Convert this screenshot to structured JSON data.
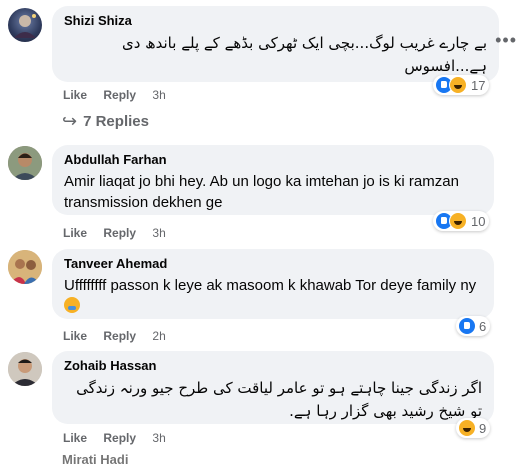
{
  "comments": [
    {
      "author": "Shizi Shiza",
      "text": "بے چارے غریب لوگ...بچی ایک ٹھرکی بڈھے کے پلے باندھ دی ہے...افسوس",
      "actions": {
        "like": "Like",
        "reply": "Reply",
        "time": "3h"
      },
      "reaction_count": "17",
      "reactions": [
        "like-icon",
        "haha-icon"
      ],
      "replies_label": "7 Replies"
    },
    {
      "author": "Abdullah Farhan",
      "text": "Amir liaqat jo bhi hey. Ab un logo ka imtehan jo is ki ramzan transmission dekhen ge",
      "actions": {
        "like": "Like",
        "reply": "Reply",
        "time": "3h"
      },
      "reaction_count": "10",
      "reactions": [
        "like-icon",
        "haha-icon"
      ]
    },
    {
      "author": "Tanveer Ahemad",
      "text": "Uffffffff passon k leye ak masoom k khawab Tor deye family ny",
      "actions": {
        "like": "Like",
        "reply": "Reply",
        "time": "2h"
      },
      "reaction_count": "6",
      "reactions": [
        "like-icon"
      ]
    },
    {
      "author": "Zohaib Hassan",
      "text": "اگر زندگی جینا چاہتے ہو تو عامر لیاقت کی طرح جیو ورنہ زندگی تو شیخ رشید بھی گزار رہا ہے.",
      "actions": {
        "like": "Like",
        "reply": "Reply",
        "time": "3h"
      },
      "reaction_count": "9",
      "reactions": [
        "haha-icon"
      ]
    }
  ],
  "more_label": "•••",
  "partial_next_author": "Mirati Hadi"
}
